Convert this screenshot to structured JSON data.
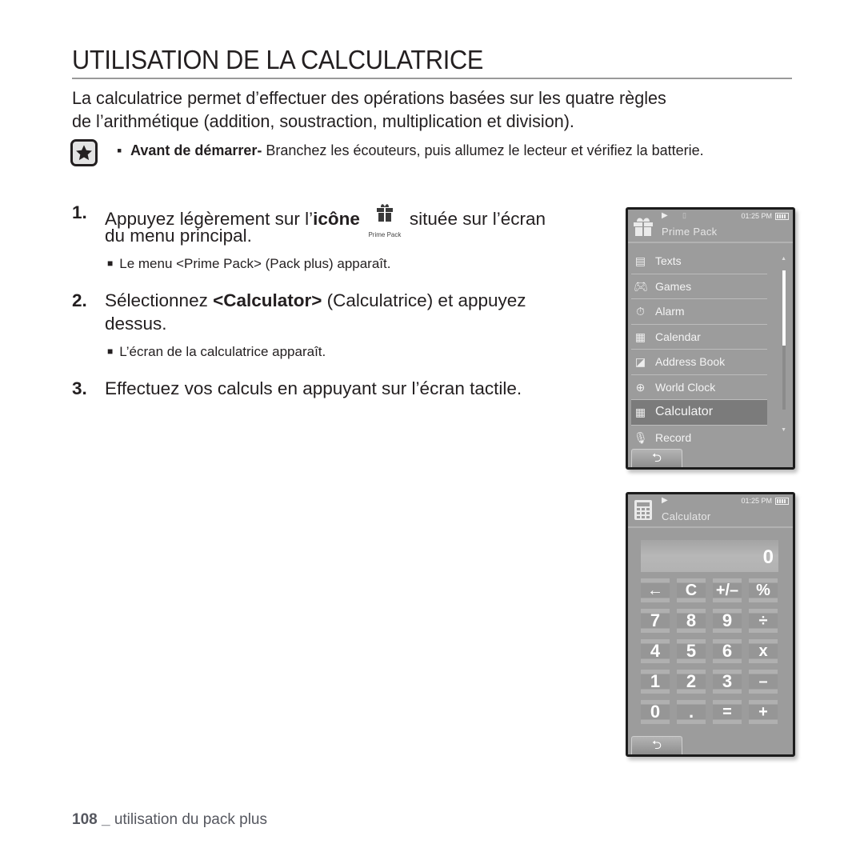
{
  "page": {
    "title": "UTILISATION DE LA CALCULATRICE",
    "intro_line1": "La calculatrice permet d’effectuer des opérations basées sur les quatre règles",
    "intro_line2": "de l’arithmétique (addition, soustraction, multiplication et division).",
    "note": {
      "icon": "star-icon",
      "bullet": "▪",
      "bold": "Avant de démarrer-",
      "text": " Branchez les écouteurs, puis allumez le lecteur et vérifiez la batterie."
    },
    "steps": [
      {
        "num": "1.",
        "pre": "Appuyez légèrement sur l’",
        "bold": "icône",
        "icon_label": "Prime Pack",
        "post": "située sur l’écran",
        "line2": "du menu principal.",
        "sub": "Le menu <Prime Pack> (Pack plus) apparaît."
      },
      {
        "num": "2.",
        "pre": "Sélectionnez ",
        "bold": "<Calculator>",
        "post": " (Calculatrice) et appuyez",
        "line2": "dessus.",
        "sub": "L’écran de la calculatrice apparaît."
      },
      {
        "num": "3.",
        "text": "Effectuez vos calculs en appuyant sur l’écran tactile."
      }
    ],
    "footer_page": "108 _",
    "footer_text": " utilisation du pack plus"
  },
  "screen_menu": {
    "status_time": "01:25 PM",
    "app_name": "Prime Pack",
    "items": [
      {
        "label": "Texts",
        "icon": "document-icon"
      },
      {
        "label": "Games",
        "icon": "gamepad-icon"
      },
      {
        "label": "Alarm",
        "icon": "stopwatch-icon"
      },
      {
        "label": "Calendar",
        "icon": "calendar-icon"
      },
      {
        "label": "Address Book",
        "icon": "address-book-icon"
      },
      {
        "label": "World Clock",
        "icon": "globe-icon"
      },
      {
        "label": "Calculator",
        "icon": "calculator-icon",
        "selected": true
      },
      {
        "label": "Record",
        "icon": "microphone-icon"
      }
    ],
    "back_glyph": "⮌"
  },
  "screen_calc": {
    "status_time": "01:25 PM",
    "app_name": "Calculator",
    "display_value": "0",
    "keys": [
      "←",
      "C",
      "+/–",
      "%",
      "7",
      "8",
      "9",
      "÷",
      "4",
      "5",
      "6",
      "x",
      "1",
      "2",
      "3",
      "–",
      "0",
      ".",
      "=",
      "+"
    ],
    "back_glyph": "⮌"
  }
}
